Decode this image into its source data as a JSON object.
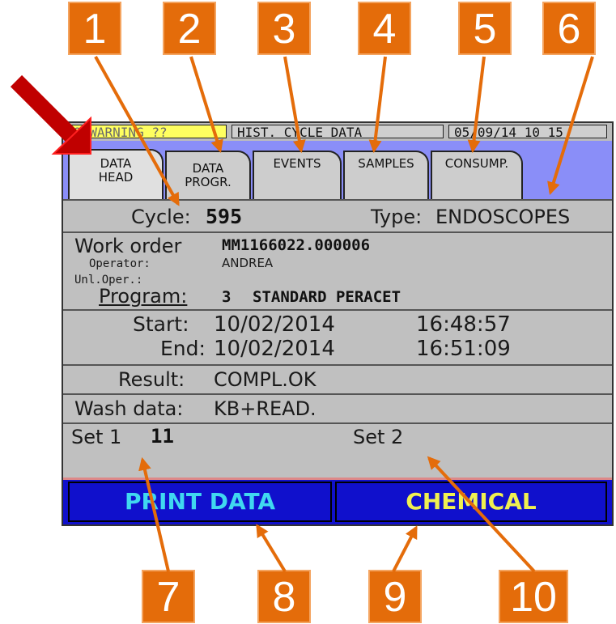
{
  "callouts": [
    "1",
    "2",
    "3",
    "4",
    "5",
    "6",
    "7",
    "8",
    "9",
    "10"
  ],
  "status": {
    "warning": "9 WARNING ??",
    "title": "HIST. CYCLE DATA",
    "datetime": "05/09/14 10 15"
  },
  "tabs": [
    {
      "line1": "DATA",
      "line2": "HEAD"
    },
    {
      "line1": "DATA",
      "line2": "PROGR."
    },
    {
      "line1": "EVENTS",
      "line2": ""
    },
    {
      "line1": "SAMPLES",
      "line2": ""
    },
    {
      "line1": "CONSUMP.",
      "line2": ""
    }
  ],
  "cycle": {
    "label": "Cycle:",
    "value": "595"
  },
  "type": {
    "label": "Type:",
    "value": "ENDOSCOPES"
  },
  "work_order": {
    "label": "Work order",
    "value": "MM1166022.000006"
  },
  "operator": {
    "label": "Operator:",
    "value": "ANDREA"
  },
  "unl_oper": {
    "label": "Unl.Oper.:",
    "value": ""
  },
  "program": {
    "label": "Program:",
    "number": "3",
    "name": "STANDARD PERACET"
  },
  "start": {
    "label": "Start:",
    "date": "10/02/2014",
    "time": "16:48:57"
  },
  "end": {
    "label": "End:",
    "date": "10/02/2014",
    "time": "16:51:09"
  },
  "result": {
    "label": "Result:",
    "value": "COMPL.OK"
  },
  "wash": {
    "label": "Wash data:",
    "value": "KB+READ."
  },
  "set1": {
    "label": "Set 1",
    "value": "11"
  },
  "set2": {
    "label": "Set 2",
    "value": ""
  },
  "buttons": {
    "print": "PRINT DATA",
    "chemical": "CHEMICAL"
  },
  "colors": {
    "callout": "#e46c0a",
    "arrow_main": "#c00000",
    "tab_bar": "#8a8ef8",
    "button_bar": "#1010cc"
  }
}
